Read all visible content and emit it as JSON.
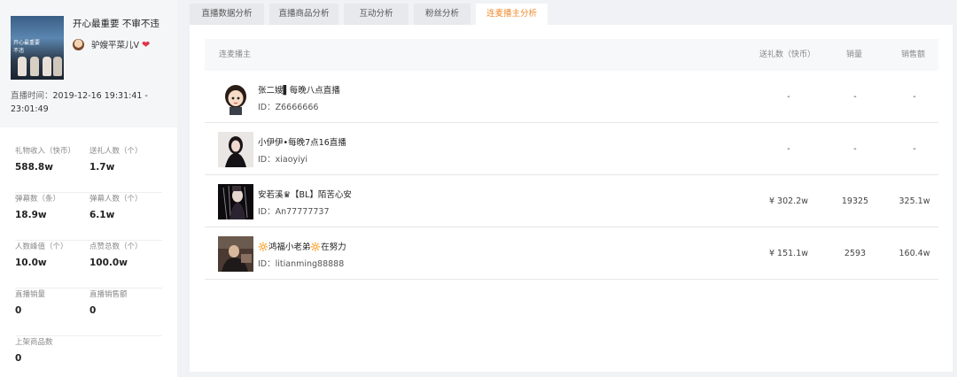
{
  "anchor": {
    "title": "开心最重要 不审不违",
    "name": "驴嫂平菜儿V",
    "cover_text": "开心最重要\n不违",
    "live_time_label": "直播时间：",
    "live_time_value": "2019-12-16 19:31:41 - 23:01:49"
  },
  "stats": [
    {
      "label": "礼物收入（快币）",
      "value": "588.8w"
    },
    {
      "label": "送礼人数（个）",
      "value": "1.7w"
    },
    {
      "label": "弹幕数（条）",
      "value": "18.9w"
    },
    {
      "label": "弹幕人数（个）",
      "value": "6.1w"
    },
    {
      "label": "人数峰值（个）",
      "value": "10.0w"
    },
    {
      "label": "点赞总数（个）",
      "value": "100.0w"
    },
    {
      "label": "直播销量",
      "value": "0"
    },
    {
      "label": "直播销售额",
      "value": "0"
    },
    {
      "label": "上架商品数",
      "value": "0"
    }
  ],
  "tabs": [
    {
      "label": "直播数据分析",
      "active": false
    },
    {
      "label": "直播商品分析",
      "active": false
    },
    {
      "label": "互动分析",
      "active": false
    },
    {
      "label": "粉丝分析",
      "active": false
    },
    {
      "label": "连麦播主分析",
      "active": true
    }
  ],
  "table": {
    "headers": {
      "anchor": "连麦播主",
      "gifts": "送礼数（快币）",
      "sales": "销量",
      "amount": "销售额"
    },
    "rows": [
      {
        "name": "张二嫂▌每晚八点直播",
        "id": "ID：Z6666666",
        "gifts": "-",
        "sales": "-",
        "amount": "-"
      },
      {
        "name": "小伊伊•每晚7点16直播",
        "id": "ID：xiaoyiyi",
        "gifts": "-",
        "sales": "-",
        "amount": "-"
      },
      {
        "name": "安若溪♛【BL】陌苦心安",
        "id": "ID：An77777737",
        "gifts": "¥ 302.2w",
        "sales": "19325",
        "amount": "325.1w"
      },
      {
        "name": "🔆鸿福小老弟🔆在努力",
        "id": "ID：litianming88888",
        "gifts": "¥ 151.1w",
        "sales": "2593",
        "amount": "160.4w"
      }
    ]
  },
  "colors": {
    "accent": "#f08a2c",
    "heart": "#e0344a",
    "page_bg": "#f0f2f5"
  }
}
